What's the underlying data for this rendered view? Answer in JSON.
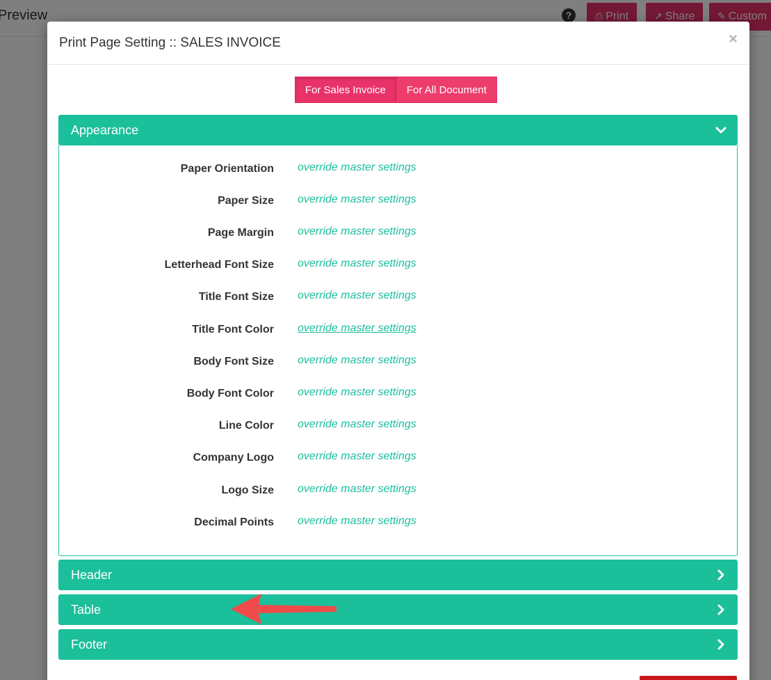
{
  "background": {
    "page_title": "Preview",
    "help_icon": "question-circle-icon",
    "buttons": [
      {
        "label": "Print",
        "icon": "print-icon"
      },
      {
        "label": "Share",
        "icon": "share-icon"
      },
      {
        "label": "Custom",
        "icon": "brush-icon"
      }
    ]
  },
  "modal": {
    "title": "Print Page Setting :: SALES INVOICE",
    "close_label": "×",
    "tabs": [
      {
        "label": "For Sales Invoice",
        "active": true
      },
      {
        "label": "For All Document",
        "active": false
      }
    ],
    "panels": {
      "appearance": {
        "title": "Appearance",
        "expanded": true,
        "rows": [
          {
            "label": "Paper Orientation",
            "value": "override master settings"
          },
          {
            "label": "Paper Size",
            "value": "override master settings"
          },
          {
            "label": "Page Margin",
            "value": "override master settings"
          },
          {
            "label": "Letterhead Font Size",
            "value": "override master settings"
          },
          {
            "label": "Title Font Size",
            "value": "override master settings"
          },
          {
            "label": "Title Font Color",
            "value": "override master settings"
          },
          {
            "label": "Body Font Size",
            "value": "override master settings"
          },
          {
            "label": "Body Font Color",
            "value": "override master settings"
          },
          {
            "label": "Line Color",
            "value": "override master settings"
          },
          {
            "label": "Company Logo",
            "value": "override master settings"
          },
          {
            "label": "Logo Size",
            "value": "override master settings"
          },
          {
            "label": "Decimal Points",
            "value": "override master settings"
          }
        ]
      },
      "header": {
        "title": "Header",
        "expanded": false
      },
      "table": {
        "title": "Table",
        "expanded": false
      },
      "footer": {
        "title": "Footer",
        "expanded": false
      }
    }
  },
  "colors": {
    "accent_green": "#1bbf9a",
    "accent_pink": "#e8336a",
    "annotation_red": "#f04b4b"
  }
}
